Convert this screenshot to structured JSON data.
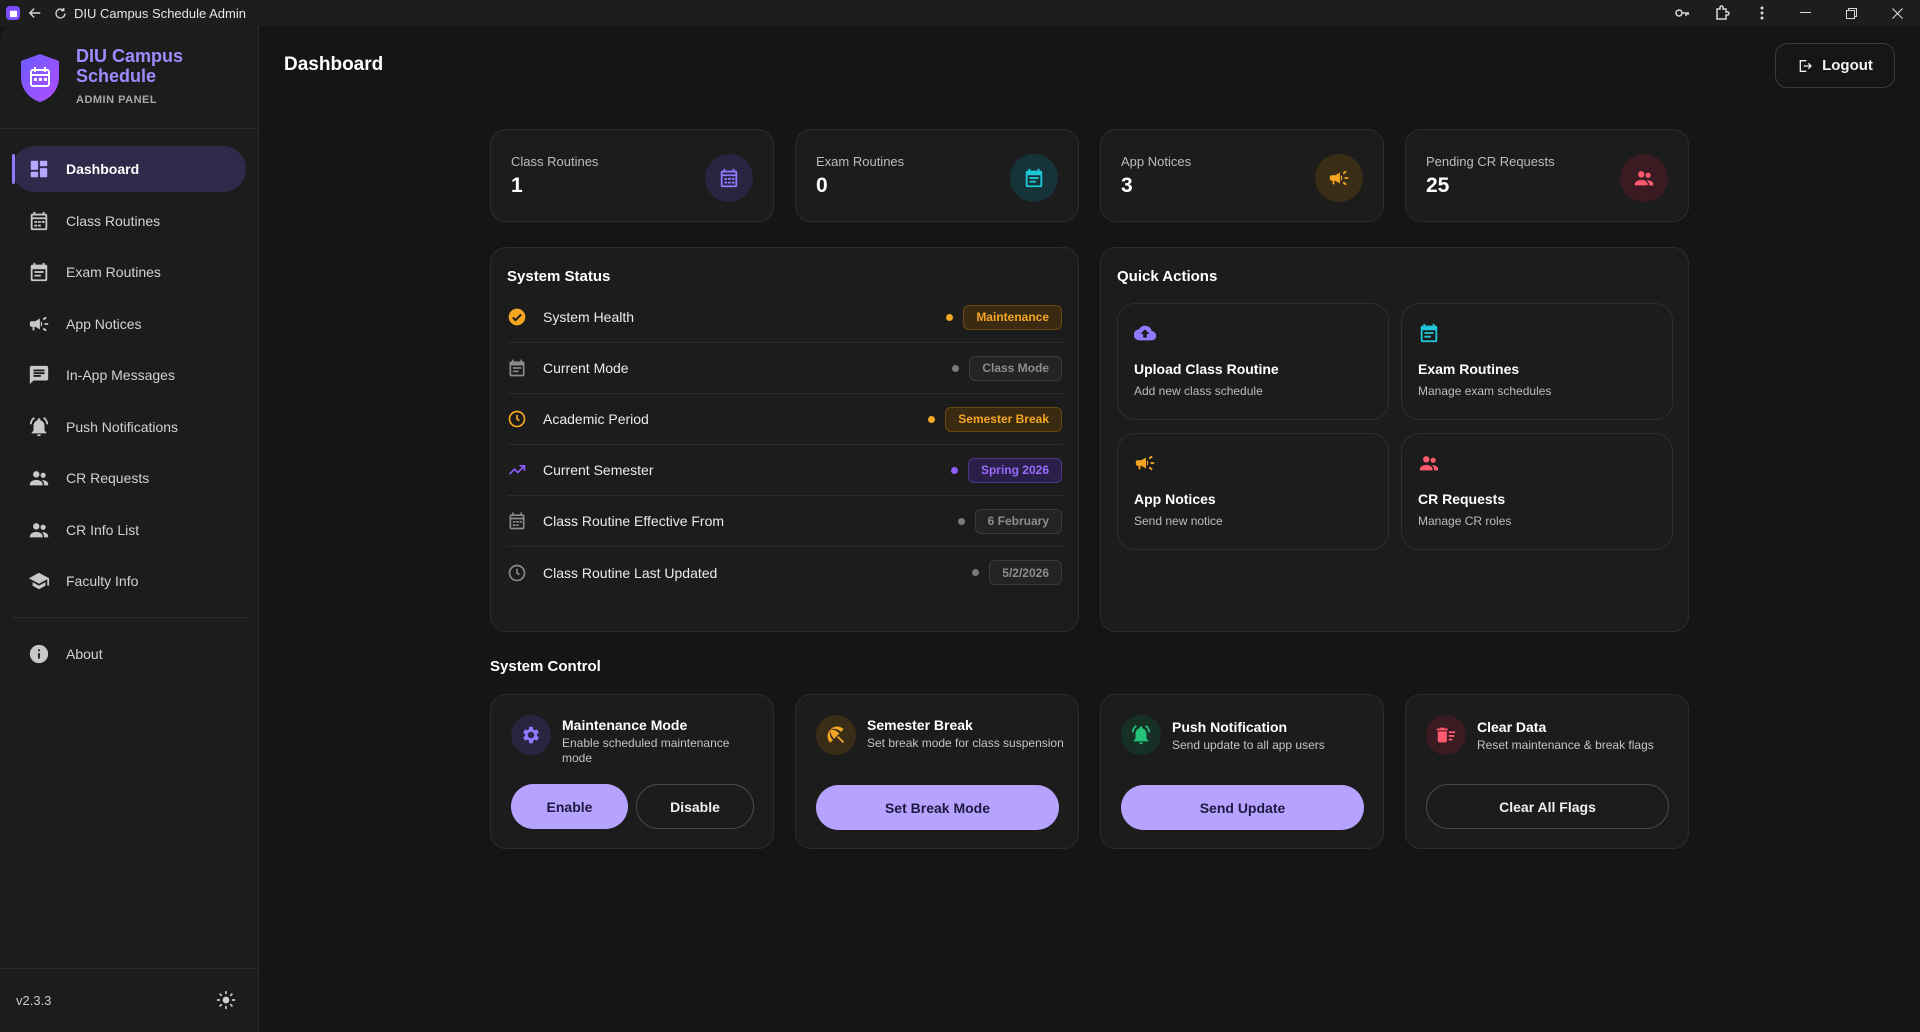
{
  "window": {
    "title": "DIU Campus Schedule Admin"
  },
  "brand": {
    "title": "DIU Campus Schedule",
    "subtitle": "ADMIN PANEL"
  },
  "sidebar": {
    "items": [
      {
        "label": "Dashboard",
        "icon": "dashboard-icon",
        "active": true
      },
      {
        "label": "Class Routines",
        "icon": "calendar-icon"
      },
      {
        "label": "Exam Routines",
        "icon": "event-note-icon"
      },
      {
        "label": "App Notices",
        "icon": "megaphone-icon"
      },
      {
        "label": "In-App Messages",
        "icon": "message-icon"
      },
      {
        "label": "Push Notifications",
        "icon": "bell-icon"
      },
      {
        "label": "CR Requests",
        "icon": "people-icon"
      },
      {
        "label": "CR Info List",
        "icon": "people-icon"
      },
      {
        "label": "Faculty Info",
        "icon": "school-icon"
      }
    ],
    "about": {
      "label": "About",
      "icon": "info-icon"
    },
    "version": "v2.3.3"
  },
  "header": {
    "title": "Dashboard",
    "logout_label": "Logout"
  },
  "stats": [
    {
      "label": "Class Routines",
      "value": "1",
      "icon": "calendar-icon",
      "color": "#8e7bff"
    },
    {
      "label": "Exam Routines",
      "value": "0",
      "icon": "event-note-icon",
      "color": "#1ec8d8"
    },
    {
      "label": "App Notices",
      "value": "3",
      "icon": "megaphone-icon",
      "color": "#f5a623"
    },
    {
      "label": "Pending CR Requests",
      "value": "25",
      "icon": "people-icon",
      "color": "#ff5a6e"
    }
  ],
  "system_status": {
    "title": "System Status",
    "rows": [
      {
        "label": "System Health",
        "icon": "check-circle-icon",
        "badge": "Maintenance",
        "tone": "orange"
      },
      {
        "label": "Current Mode",
        "icon": "calendar-icon",
        "badge": "Class Mode",
        "tone": "gray"
      },
      {
        "label": "Academic Period",
        "icon": "clock-icon",
        "badge": "Semester Break",
        "tone": "orange"
      },
      {
        "label": "Current Semester",
        "icon": "trending-up-icon",
        "badge": "Spring 2026",
        "tone": "purple"
      },
      {
        "label": "Class Routine Effective From",
        "icon": "calendar-icon",
        "badge": "6 February",
        "tone": "gray"
      },
      {
        "label": "Class Routine Last Updated",
        "icon": "clock-icon",
        "badge": "5/2/2026",
        "tone": "gray"
      }
    ]
  },
  "quick_actions": {
    "title": "Quick Actions",
    "items": [
      {
        "title": "Upload Class Routine",
        "desc": "Add new class schedule",
        "icon": "cloud-upload-icon",
        "color": "#8e7bff"
      },
      {
        "title": "Exam Routines",
        "desc": "Manage exam schedules",
        "icon": "event-note-icon",
        "color": "#1ec8d8"
      },
      {
        "title": "App Notices",
        "desc": "Send new notice",
        "icon": "megaphone-icon",
        "color": "#f5a623"
      },
      {
        "title": "CR Requests",
        "desc": "Manage CR roles",
        "icon": "people-icon",
        "color": "#ff5a6e"
      }
    ]
  },
  "system_control": {
    "title": "System Control",
    "cards": [
      {
        "title": "Maintenance Mode",
        "desc": "Enable scheduled maintenance mode",
        "icon": "gear-icon",
        "buttons": [
          "Enable",
          "Disable"
        ]
      },
      {
        "title": "Semester Break",
        "desc": "Set break mode for class suspension",
        "icon": "beach-umbrella-icon",
        "buttons": [
          "Set Break Mode"
        ]
      },
      {
        "title": "Push Notification",
        "desc": "Send update to all app users",
        "icon": "bell-icon",
        "buttons": [
          "Send Update"
        ]
      },
      {
        "title": "Clear Data",
        "desc": "Reset maintenance & break flags",
        "icon": "delete-sweep-icon",
        "buttons": [
          "Clear All Flags"
        ]
      }
    ]
  },
  "colors": {
    "accent": "#b6a3ff",
    "brand": "#9b8cff",
    "orange": "#f5a623",
    "purple": "#8e5cff",
    "teal": "#1ec8d8",
    "red": "#ff5a6e",
    "green": "#25c27a"
  }
}
